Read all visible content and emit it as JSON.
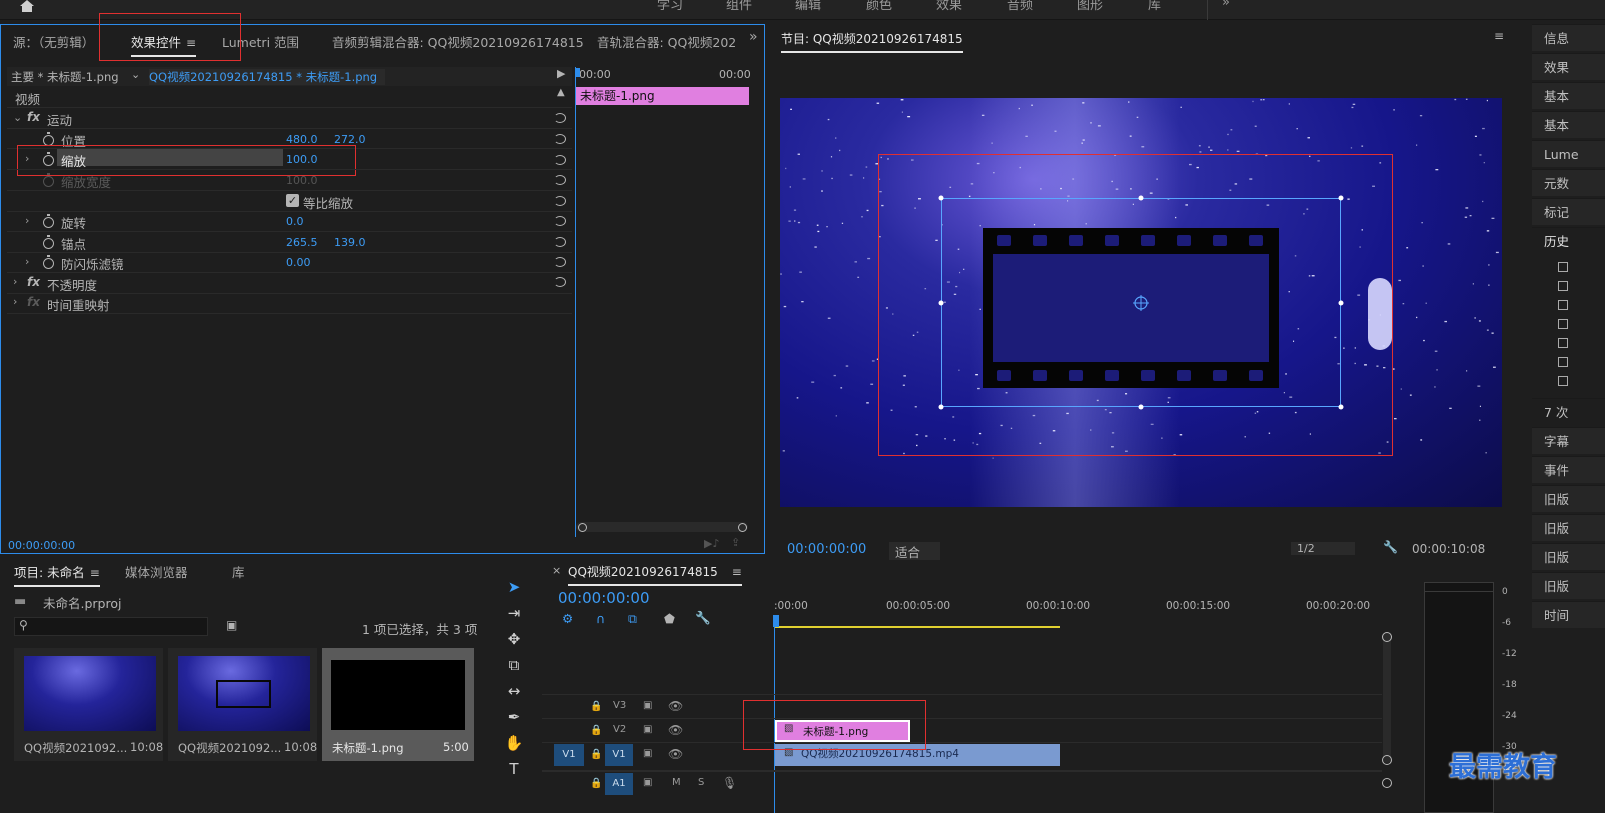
{
  "topbar": {
    "tabs": [
      "学习",
      "组件",
      "编辑",
      "颜色",
      "效果",
      "音频",
      "图形",
      "库"
    ],
    "more": "»"
  },
  "effect_controls": {
    "tabs": [
      "源：（无剪辑）",
      "效果控件",
      "Lumetri 范围",
      "音频剪辑混合器: QQ视频20210926174815",
      "音轨混合器: QQ视频202"
    ],
    "more": "»",
    "master_label": "主要 * 未标题-1.png",
    "sequence_clip": "QQ视频20210926174815 * 未标题-1.png",
    "section_video": "视频",
    "motion": "运动",
    "position_label": "位置",
    "position_x": "480.0",
    "position_y": "272.0",
    "scale_label": "缩放",
    "scale_value": "100.0",
    "scale_width_label": "缩放宽度",
    "scale_width_value": "100.0",
    "uniform_scale": "等比缩放",
    "rotation_label": "旋转",
    "rotation_value": "0.0",
    "anchor_label": "锚点",
    "anchor_x": "265.5",
    "anchor_y": "139.0",
    "antiflicker_label": "防闪烁滤镜",
    "antiflicker_value": "0.00",
    "opacity": "不透明度",
    "time_remap": "时间重映射",
    "tl_start": "00:00",
    "tl_end": "00:00",
    "tl_clip": "未标题-1.png",
    "timecode": "00:00:00:00"
  },
  "program": {
    "title": "节目: QQ视频20210926174815",
    "timecode": "00:00:00:00",
    "fit": "适合",
    "quality": "1/2",
    "duration": "00:00:10:08"
  },
  "side_panels": [
    "信息",
    "效果",
    "基本",
    "基本",
    "Lume",
    "元数",
    "标记",
    "历史",
    "7 次",
    "字幕",
    "事件",
    "旧版",
    "旧版",
    "旧版",
    "旧版",
    "时间"
  ],
  "project": {
    "tabs": [
      "项目: 未命名",
      "媒体浏览器",
      "库"
    ],
    "file": "未命名.prproj",
    "selection": "1 项已选择，共 3 项",
    "items": [
      {
        "name": "QQ视频2021092...",
        "duration": "10:08"
      },
      {
        "name": "QQ视频2021092...",
        "duration": "10:08"
      },
      {
        "name": "未标题-1.png",
        "duration": "5:00"
      }
    ]
  },
  "timeline": {
    "title": "QQ视频20210926174815",
    "timecode": "00:00:00:00",
    "ruler": [
      ":00:00",
      "00:00:05:00",
      "00:00:10:00",
      "00:00:15:00",
      "00:00:20:00"
    ],
    "tracks": [
      "V3",
      "V2",
      "V1",
      "A1"
    ],
    "src_v1": "V1",
    "src_a1": "A1",
    "clip_v2": "未标题-1.png",
    "clip_v1": "QQ视频20210926174815.mp4",
    "m": "M",
    "s": "S"
  },
  "meter": {
    "scale": [
      "0",
      "-6",
      "-12",
      "-18",
      "-24",
      "-30"
    ]
  },
  "watermark": "最需教育",
  "colors": {
    "accent": "#2d8ceb",
    "value_blue": "#3d9cf5",
    "clip_pink": "#e07fe0",
    "clip_blue": "#7a9ad0",
    "highlight_red": "#e03030"
  }
}
